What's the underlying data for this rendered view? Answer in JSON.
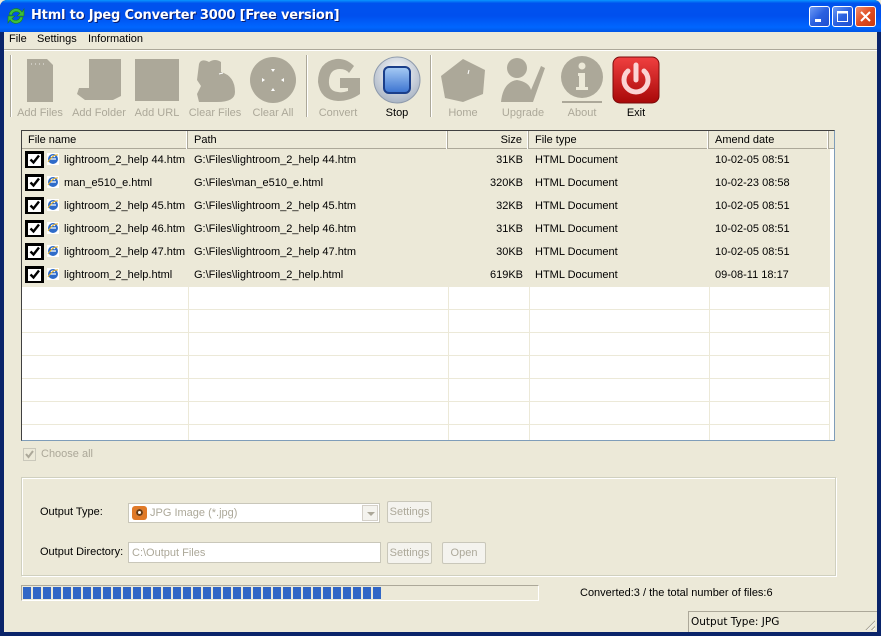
{
  "window": {
    "title": "Html to Jpeg Converter 3000 [Free version]",
    "controls": [
      "minimize",
      "maximize",
      "close"
    ]
  },
  "menu": {
    "items": [
      {
        "label": "File"
      },
      {
        "label": "Settings"
      },
      {
        "label": "Information"
      }
    ]
  },
  "toolbar": {
    "buttons": [
      {
        "label": "Add Files",
        "icon": "add-files-icon",
        "enabled": false
      },
      {
        "label": "Add Folder",
        "icon": "add-folder-icon",
        "enabled": false
      },
      {
        "label": "Add URL",
        "icon": "add-url-icon",
        "enabled": false
      },
      {
        "label": "Clear Files",
        "icon": "clear-files-icon",
        "enabled": false
      },
      {
        "label": "Clear All",
        "icon": "clear-all-icon",
        "enabled": false
      },
      {
        "label": "Convert",
        "icon": "convert-icon",
        "enabled": false
      },
      {
        "label": "Stop",
        "icon": "stop-icon",
        "enabled": true
      },
      {
        "label": "Home",
        "icon": "home-icon",
        "enabled": false
      },
      {
        "label": "Upgrade",
        "icon": "upgrade-icon",
        "enabled": false
      },
      {
        "label": "About",
        "icon": "about-icon",
        "enabled": false
      },
      {
        "label": "Exit",
        "icon": "power-icon",
        "enabled": true
      }
    ]
  },
  "file_list": {
    "columns": [
      {
        "label": "File name"
      },
      {
        "label": "Path"
      },
      {
        "label": "Size"
      },
      {
        "label": "File type"
      },
      {
        "label": "Amend date"
      }
    ],
    "rows": [
      {
        "checked": true,
        "name": "lightroom_2_help 44.htm",
        "path": "G:\\Files\\lightroom_2_help 44.htm",
        "size": "31KB",
        "type": "HTML Document",
        "date": "10-02-05 08:51"
      },
      {
        "checked": true,
        "name": "man_e510_e.html",
        "path": "G:\\Files\\man_e510_e.html",
        "size": "320KB",
        "type": "HTML Document",
        "date": "10-02-23 08:58"
      },
      {
        "checked": true,
        "name": "lightroom_2_help 45.htm",
        "path": "G:\\Files\\lightroom_2_help 45.htm",
        "size": "32KB",
        "type": "HTML Document",
        "date": "10-02-05 08:51"
      },
      {
        "checked": true,
        "name": "lightroom_2_help 46.htm",
        "path": "G:\\Files\\lightroom_2_help 46.htm",
        "size": "31KB",
        "type": "HTML Document",
        "date": "10-02-05 08:51"
      },
      {
        "checked": true,
        "name": "lightroom_2_help 47.htm",
        "path": "G:\\Files\\lightroom_2_help 47.htm",
        "size": "30KB",
        "type": "HTML Document",
        "date": "10-02-05 08:51"
      },
      {
        "checked": true,
        "name": "lightroom_2_help.html",
        "path": "G:\\Files\\lightroom_2_help.html",
        "size": "619KB",
        "type": "HTML Document",
        "date": "09-08-11 18:17"
      }
    ]
  },
  "choose_all": {
    "label": "Choose all",
    "checked": true,
    "enabled": false
  },
  "output": {
    "type_label": "Output Type:",
    "type_value": "JPG Image (*.jpg)",
    "type_settings_label": "Settings",
    "dir_label": "Output Directory:",
    "dir_value": "C:\\Output Files",
    "dir_settings_label": "Settings",
    "open_label": "Open"
  },
  "progress": {
    "fraction": 0.71,
    "status_text": "Converted:3  /  the total number of files:6"
  },
  "statusbar": {
    "text": "Output Type: JPG"
  },
  "colors": {
    "progress_fill": "#3167C6",
    "title_bar": "#0053EE",
    "exit_red": "#D42020"
  }
}
